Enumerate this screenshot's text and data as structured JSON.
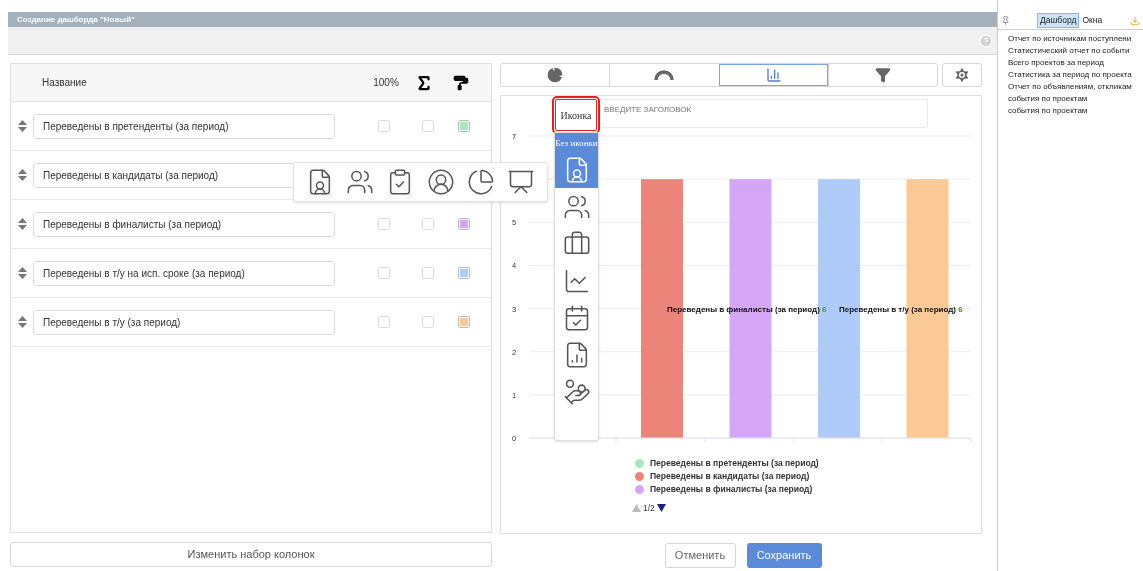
{
  "window": {
    "title": "Создание дашборда \"Новый\""
  },
  "columns_table": {
    "headers": {
      "name": "Название",
      "percent": "100%"
    },
    "rows": [
      {
        "name": "Переведены в претенденты (за период)",
        "percent_checked": false,
        "sum_checked": false,
        "color": "#a8e6c0"
      },
      {
        "name": "Переведены в кандидаты (за период)"
      },
      {
        "name": "Переведены в финалисты (за период)",
        "percent_checked": false,
        "sum_checked": false,
        "color": "#d5a6f5"
      },
      {
        "name": "Переведены в т/у на исп. сроке (за период)",
        "percent_checked": false,
        "sum_checked": false,
        "color": "#aecbfa"
      },
      {
        "name": "Переведены в т/у (за период)",
        "percent_checked": false,
        "sum_checked": false,
        "color": "#fbc995"
      }
    ],
    "change_columns_button": "Изменить набор колонок"
  },
  "chart_tabs": [
    {
      "kind": "pie",
      "selected": false
    },
    {
      "kind": "gauge",
      "selected": false
    },
    {
      "kind": "bar",
      "selected": true
    },
    {
      "kind": "funnel",
      "selected": false
    }
  ],
  "chart_panel": {
    "icon_button": {
      "label": "Иконка",
      "highlighted": true
    },
    "title_field": {
      "placeholder": "ВВЕДИТЕ ЗАГОЛОВОК"
    },
    "chart_data": {
      "type": "bar",
      "ylim": [
        0,
        7
      ],
      "yticks": [
        0,
        1,
        2,
        3,
        4,
        5,
        7
      ],
      "grid": true,
      "series": [
        {
          "values": [
            null
          ]
        },
        {
          "color": "#ec8579",
          "values": [
            6
          ]
        },
        {
          "color": "#d5a6f5",
          "values": [
            6
          ]
        },
        {
          "color": "#aecbfa",
          "values": [
            6
          ]
        },
        {
          "color": "#fbc995",
          "values": [
            6
          ]
        }
      ]
    },
    "data_labels": [
      {
        "text": "Переведены в финалисты (за период)",
        "value": "6"
      },
      {
        "text": "Переведены в т/у (за период)",
        "value": "6"
      }
    ],
    "legend": [
      {
        "label": "Переведены в претенденты (за период)",
        "color": "#a8e6c0"
      },
      {
        "label": "Переведены в кандидаты (за период)",
        "color": "#ec8579"
      },
      {
        "label": "Переведены в финалисты (за период)",
        "color": "#d5a6f5"
      }
    ],
    "legend_pager": {
      "text": "1/2",
      "prev_disabled": true
    }
  },
  "icon_menu": {
    "no_icon_label": "Без иконки",
    "items": [
      {
        "kind": "file-user",
        "selected": true
      },
      {
        "kind": "users",
        "selected": false
      },
      {
        "kind": "briefcase",
        "selected": false
      },
      {
        "kind": "chart-line",
        "selected": false
      },
      {
        "kind": "calendar-check",
        "selected": false
      },
      {
        "kind": "file-chart",
        "selected": false
      },
      {
        "kind": "hand-coins",
        "selected": false
      }
    ]
  },
  "icon_strip": [
    {
      "kind": "file-user"
    },
    {
      "kind": "users"
    },
    {
      "kind": "clipboard-check"
    },
    {
      "kind": "user-circle"
    },
    {
      "kind": "chart-pie"
    },
    {
      "kind": "presentation"
    }
  ],
  "buttons": {
    "cancel": "Отменить",
    "save": "Сохранить"
  },
  "side_panel": {
    "tabs": [
      {
        "label": "Дашборд",
        "selected": true
      },
      {
        "label": "Окна",
        "selected": false
      }
    ],
    "items": [
      "Отчет по источникам поступлени",
      "Статистический отчет по событи",
      "Всего проектов за период",
      "Статистика за период по проекта",
      "Отчет по объявлениям, откликам",
      "события по проектам",
      "события по проектам"
    ]
  }
}
